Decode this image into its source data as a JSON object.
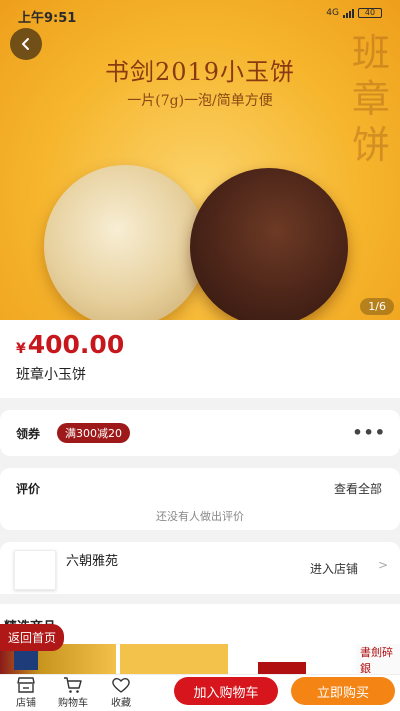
{
  "status_bar": {
    "time": "上午9:51",
    "network": "4G",
    "battery": "40"
  },
  "hero": {
    "title": "书剑2019小玉饼",
    "subtitle": "一片(7g)一泡/简单方便",
    "calligraphy": "班章饼",
    "page_indicator": "1/6"
  },
  "product": {
    "currency": "¥",
    "price": "400.00",
    "name": "班章小玉饼"
  },
  "coupon": {
    "label": "领券",
    "badge": "满300减20",
    "more": "•••"
  },
  "review": {
    "title": "评价",
    "view_all": "查看全部",
    "empty_text": "还没有人做出评价"
  },
  "shop": {
    "name": "六朝雅苑",
    "enter_label": "进入店铺",
    "arrow": ">"
  },
  "recommend": {
    "heading": "精选商品",
    "img4_text": "書劍碎銀"
  },
  "home_return": "返回首页",
  "bottom_bar": {
    "store_label": "店铺",
    "cart_label": "购物车",
    "favorite_label": "收藏",
    "add_to_cart": "加入购物车",
    "buy_now": "立即购买"
  },
  "colors": {
    "price_red": "#c8161d",
    "cart_button": "#d6161c",
    "buy_button": "#f48414",
    "hero_gold": "#f6b62e"
  },
  "icons": [
    "back-icon",
    "more-icon",
    "store-icon",
    "cart-icon",
    "heart-icon",
    "chevron-right-icon"
  ]
}
